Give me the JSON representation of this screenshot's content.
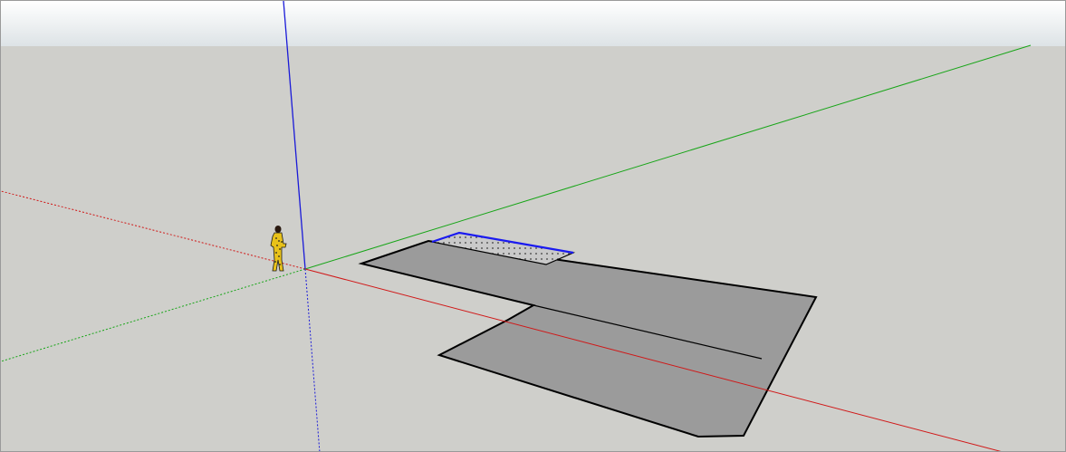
{
  "app": {
    "kind": "3D modeling viewport"
  },
  "colors": {
    "sky_top": "#ffffff",
    "sky_bottom": "#dde3e6",
    "ground": "#cfcfcb",
    "axis_red": "#d01818",
    "axis_green": "#17a517",
    "axis_blue": "#1a1ad8",
    "face_fill": "#9b9b9b",
    "edge": "#000000",
    "selected_edge": "#1a1af0",
    "selected_face_dots": "#3a3a3a",
    "figure_yellow": "#e8c21a"
  },
  "scene": {
    "objects": [
      {
        "name": "scale-figure",
        "icon": "person-figure"
      },
      {
        "name": "floor-face",
        "type": "polygon",
        "style": "face"
      },
      {
        "name": "interior-edge",
        "type": "line",
        "style": "edge"
      },
      {
        "name": "selected-face",
        "type": "polygon",
        "style": "selected"
      },
      {
        "name": "selected-edge",
        "type": "line",
        "style": "selected-edge"
      }
    ]
  }
}
